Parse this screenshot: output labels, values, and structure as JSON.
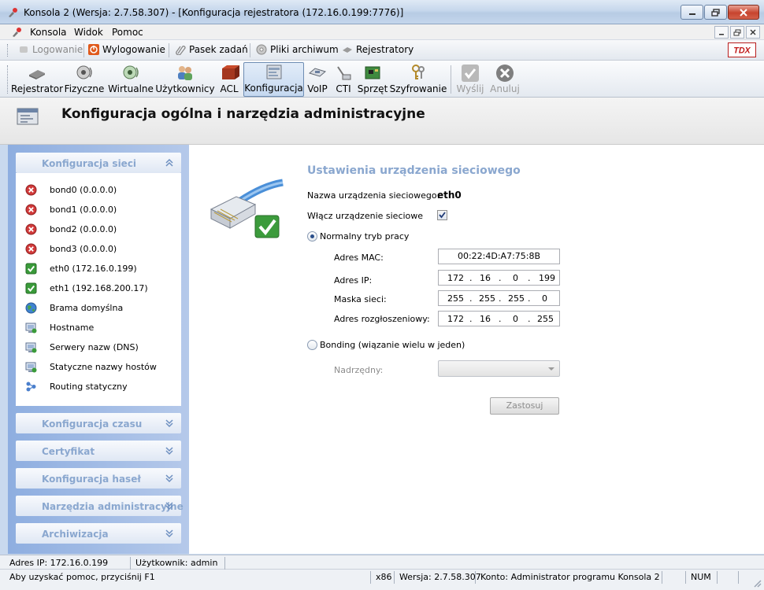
{
  "window": {
    "title": "Konsola 2 (Wersja:  2.7.58.307) - [Konfiguracja rejestratora (172.16.0.199:7776)]"
  },
  "menu": [
    "Konsola",
    "Widok",
    "Pomoc"
  ],
  "quickbar": {
    "login": "Logowanie",
    "logout": "Wylogowanie",
    "taskbar": "Pasek zadań",
    "archive": "Pliki archiwum",
    "recorders": "Rejestratory",
    "logo_text": "TDX"
  },
  "toolbar": {
    "recorder": "Rejestrator",
    "physical": "Fizyczne",
    "virtual": "Wirtualne",
    "users": "Użytkownicy",
    "acl": "ACL",
    "config": "Konfiguracja",
    "voip": "VoIP",
    "cti": "CTI",
    "hardware": "Sprzęt",
    "encryption": "Szyfrowanie",
    "send": "Wyślij",
    "cancel": "Anuluj"
  },
  "header": {
    "title": "Konfiguracja ogólna i narzędzia administracyjne"
  },
  "leftpanel": {
    "network_section": "Konfiguracja sieci",
    "items": [
      {
        "label": "bond0 (0.0.0.0)",
        "status": "error"
      },
      {
        "label": "bond1 (0.0.0.0)",
        "status": "error"
      },
      {
        "label": "bond2 (0.0.0.0)",
        "status": "error"
      },
      {
        "label": "bond3 (0.0.0.0)",
        "status": "error"
      },
      {
        "label": "eth0 (172.16.0.199)",
        "status": "ok"
      },
      {
        "label": "eth1 (192.168.200.17)",
        "status": "ok"
      },
      {
        "label": "Brama domyślna",
        "status": "globe"
      },
      {
        "label": "Hostname",
        "status": "monitor"
      },
      {
        "label": "Serwery nazw (DNS)",
        "status": "monitor"
      },
      {
        "label": "Statyczne nazwy hostów",
        "status": "monitor"
      },
      {
        "label": "Routing statyczny",
        "status": "routing"
      }
    ],
    "sections": [
      "Konfiguracja czasu",
      "Certyfikat",
      "Konfiguracja haseł",
      "Narzędzia administracyjne",
      "Archiwizacja"
    ]
  },
  "content": {
    "title": "Ustawienia urządzenia sieciowego",
    "device_name_label": "Nazwa urządzenia sieciowego:",
    "device_name_value": "eth0",
    "enable_label": "Włącz urządzenie sieciowe",
    "normal_mode_label": "Normalny tryb pracy",
    "mac_label": "Adres MAC:",
    "mac_value": "00:22:4D:A7:75:8B",
    "ip_label": "Adres IP:",
    "ip": [
      "172",
      "16",
      "0",
      "199"
    ],
    "mask_label": "Maska sieci:",
    "mask": [
      "255",
      "255",
      "255",
      "0"
    ],
    "broadcast_label": "Adres rozgłoszeniowy:",
    "broadcast": [
      "172",
      "16",
      "0",
      "255"
    ],
    "bonding_label": "Bonding (wiązanie wielu w jeden)",
    "master_label": "Nadrzędny:",
    "apply_button": "Zastosuj"
  },
  "status": {
    "ip": "Adres IP: 172.16.0.199",
    "user": "Użytkownik: admin",
    "help": "Aby uzyskać pomoc, przyciśnij F1",
    "arch": "x86",
    "version": "Wersja: 2.7.58.307",
    "account": "Konto: Administrator programu Konsola 2",
    "num": "NUM"
  }
}
